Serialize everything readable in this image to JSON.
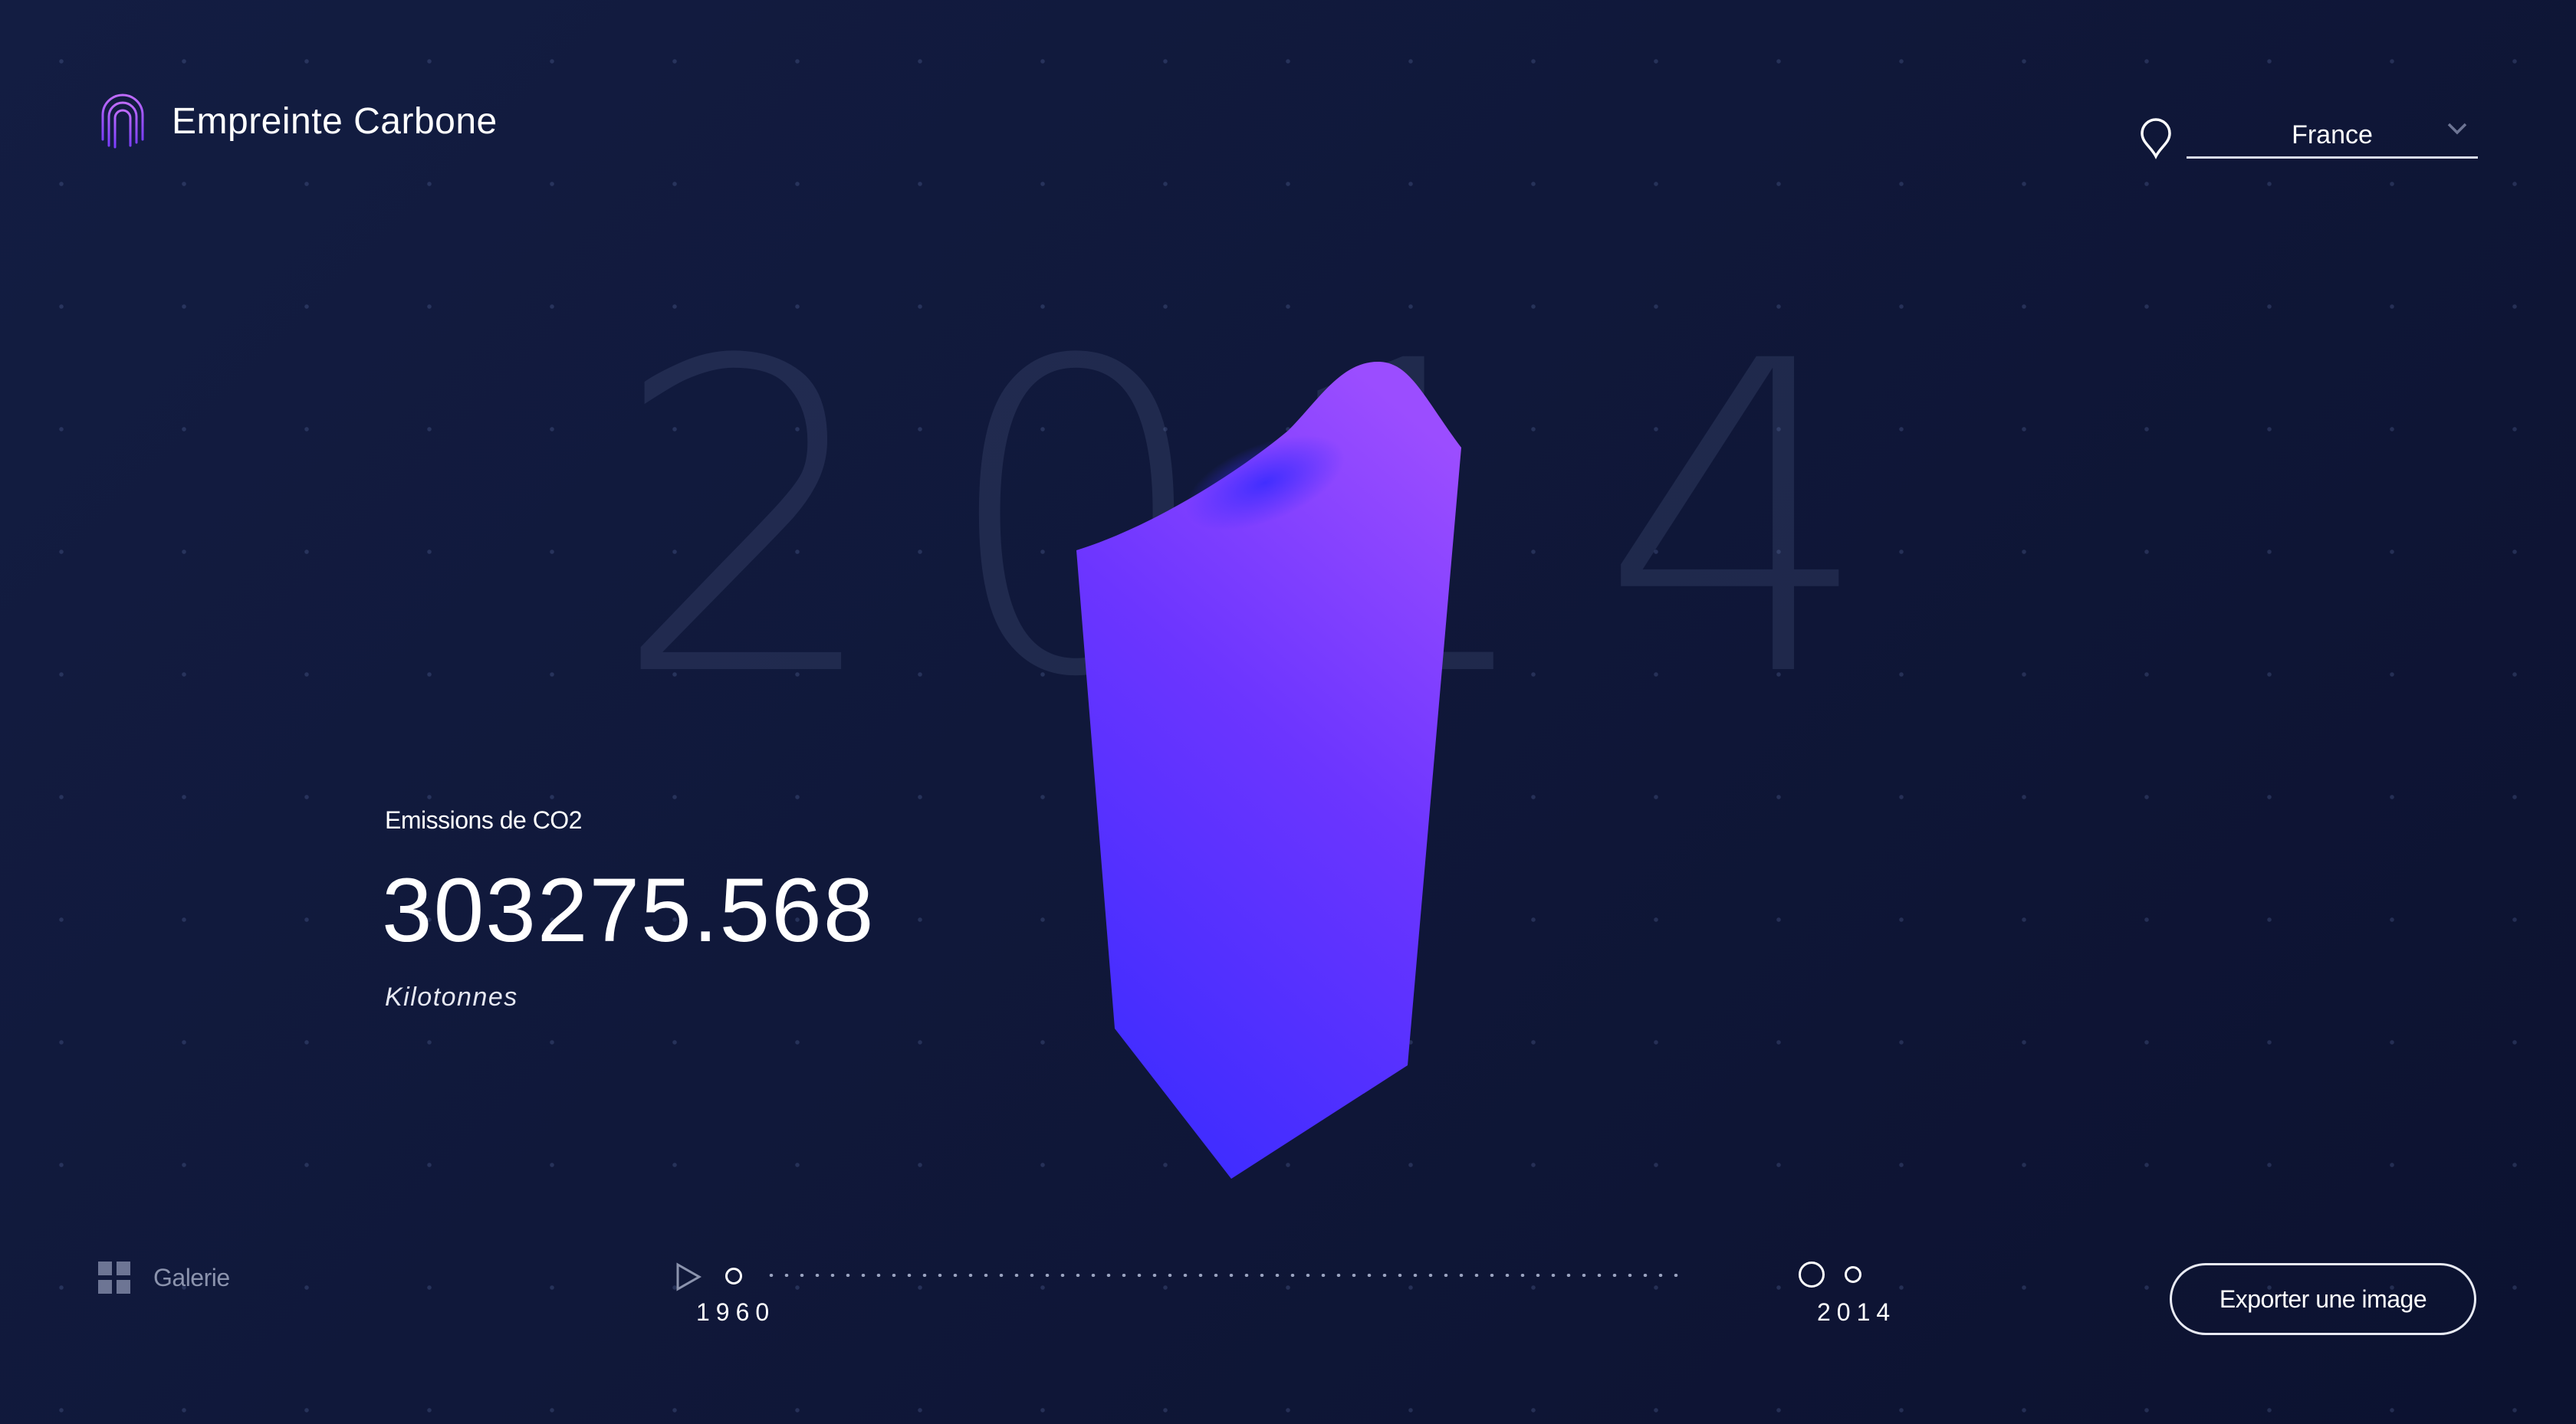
{
  "header": {
    "app_title": "Empreinte Carbone",
    "logo_icon": "fingerprint-icon",
    "country_select": {
      "icon": "map-pin-icon",
      "value": "France"
    }
  },
  "main": {
    "year": "2014",
    "year_digits": [
      "2",
      "0",
      "1",
      "4"
    ],
    "metric_label": "Emissions de CO2",
    "metric_value": "303275.568",
    "metric_unit": "Kilotonnes",
    "shape_colors": {
      "top": "#9b4dff",
      "bottom": "#3d2cff"
    }
  },
  "footer": {
    "gallery_label": "Galerie",
    "gallery_icon": "grid-icon",
    "timeline": {
      "play_icon": "play-icon",
      "start_year": "1960",
      "end_year": "2014",
      "selected_year": "2014"
    },
    "export_label": "Exporter une image"
  },
  "colors": {
    "background": "#111a3d",
    "accent": "#7b3dff",
    "text": "#ffffff",
    "muted": "#8b93ad"
  }
}
